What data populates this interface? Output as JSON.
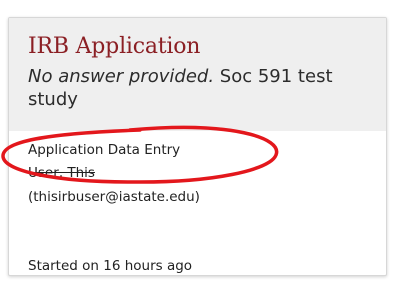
{
  "card": {
    "title": "IRB Application",
    "description_placeholder": "No answer provided.",
    "description_text": " Soc 591 test study",
    "status": "Application Data Entry",
    "user_name": "User, This",
    "user_email": "(thisirbuser@iastate.edu)",
    "started": "Started on 16 hours ago"
  },
  "colors": {
    "title": "#8b1f24",
    "header_bg": "#efefef",
    "annotation": "#e3171c"
  }
}
